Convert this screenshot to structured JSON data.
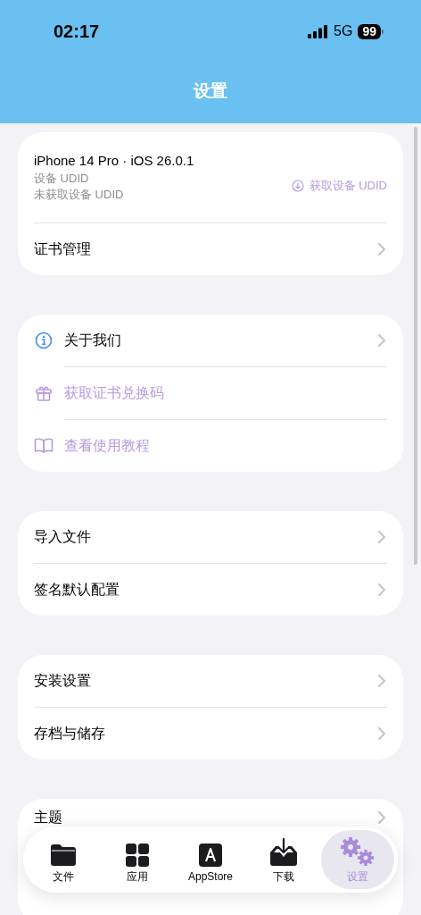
{
  "status_bar": {
    "time": "02:17",
    "network": "5G",
    "battery": "99"
  },
  "nav": {
    "title": "设置"
  },
  "device": {
    "model": "iPhone 14 Pro · iOS 26.0.1",
    "udid_label": "设备 UDID",
    "udid_value": "未获取设备 UDID",
    "action": "获取设备 UDID",
    "rows": [
      {
        "label": "证书管理",
        "kind": "nav"
      }
    ]
  },
  "sections": [
    {
      "items": [
        {
          "label": "关于我们",
          "kind": "nav"
        },
        {
          "label": "获取证书兑换码",
          "kind": "action"
        },
        {
          "label": "查看使用教程",
          "kind": "action"
        }
      ]
    },
    {
      "items": [
        {
          "label": "导入文件",
          "kind": "nav"
        },
        {
          "label": "签名默认配置",
          "kind": "nav"
        }
      ]
    },
    {
      "items": [
        {
          "label": "安装设置",
          "kind": "nav"
        },
        {
          "label": "存档与储存",
          "kind": "nav"
        }
      ]
    },
    {
      "items": [
        {
          "label": "主题",
          "kind": "nav"
        }
      ]
    }
  ],
  "tabs": [
    {
      "label": "文件",
      "selected": false
    },
    {
      "label": "应用",
      "selected": false
    },
    {
      "label": "AppStore",
      "selected": false
    },
    {
      "label": "下载",
      "selected": false
    },
    {
      "label": "设置",
      "selected": true
    }
  ]
}
